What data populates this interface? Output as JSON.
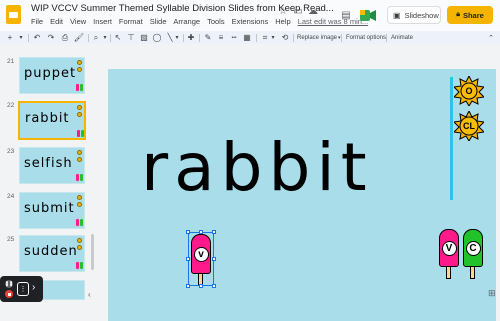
{
  "app": {
    "title": "WIP VCCV Summer Themed Syllable Division Slides from Keep Read...",
    "menu": [
      "File",
      "Edit",
      "View",
      "Insert",
      "Format",
      "Slide",
      "Arrange",
      "Tools",
      "Extensions",
      "Help"
    ],
    "last_edit": "Last edit was 8 min..."
  },
  "header": {
    "slideshow_label": "Slideshow",
    "share_label": "Share"
  },
  "toolbar": {
    "replace_image_label": "Replace image",
    "format_options_label": "Format options",
    "animate_label": "Animate"
  },
  "filmstrip": {
    "slides": [
      {
        "number": "21",
        "word": "puppet"
      },
      {
        "number": "22",
        "word": "rabbit",
        "selected": true
      },
      {
        "number": "23",
        "word": "selfish"
      },
      {
        "number": "24",
        "word": "submit"
      },
      {
        "number": "25",
        "word": "sudden"
      }
    ]
  },
  "slide": {
    "main_word": "rabbit",
    "sun_badges": [
      "O",
      "CL"
    ],
    "popsicles": [
      {
        "letter": "v",
        "color": "#ff1a8c",
        "selected": true
      },
      {
        "letter": "V",
        "color": "#ff1a8c"
      },
      {
        "letter": "C",
        "color": "#22c32a"
      }
    ]
  },
  "colors": {
    "slide_bg": "#a8dde9",
    "accent": "#f4b400",
    "popsicle_pink": "#ff1a8c",
    "popsicle_green": "#22c32a",
    "selection_blue": "#1a73e8"
  }
}
